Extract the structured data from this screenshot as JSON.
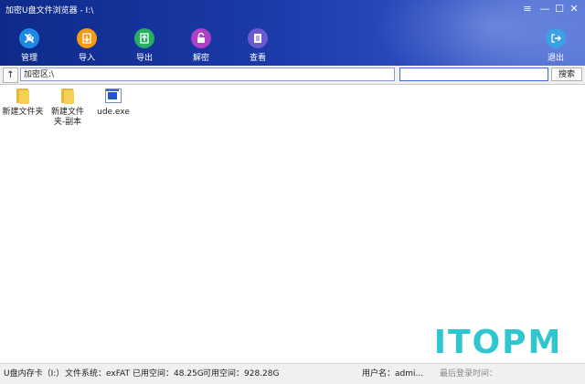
{
  "window": {
    "title": "加密U盘文件浏览器 - I:\\",
    "controls": [
      "menu-icon",
      "minimize-icon",
      "maximize-icon",
      "close-icon"
    ]
  },
  "toolbar": {
    "manage": {
      "label": "管理",
      "icon": "wrench-icon",
      "color": "#1e88e5"
    },
    "import": {
      "label": "导入",
      "icon": "import-icon",
      "color": "#f39c12"
    },
    "export": {
      "label": "导出",
      "icon": "export-icon",
      "color": "#27ae60"
    },
    "decrypt": {
      "label": "解密",
      "icon": "unlock-icon",
      "color": "#b040c8"
    },
    "view": {
      "label": "查看",
      "icon": "document-icon",
      "color": "#6a5acd"
    },
    "exit": {
      "label": "退出",
      "icon": "exit-icon",
      "color": "#3aa0e8"
    }
  },
  "address": {
    "up_label": "↑",
    "path": "加密区:\\",
    "search_placeholder": "",
    "search_button": "搜索"
  },
  "files": [
    {
      "name": "新建文件夹",
      "type": "folder"
    },
    {
      "name": "新建文件夹-副本",
      "type": "folder"
    },
    {
      "name": "ude.exe",
      "type": "exe"
    }
  ],
  "watermark": "ITOPM",
  "status": {
    "drive": "U盘内存卡（I:）",
    "filesystem": "文件系统：exFAT",
    "used": "已用空间：48.25G",
    "available": "可用空间：928.28G",
    "user": "用户名：admi...",
    "last_login": "最后登录时间："
  }
}
